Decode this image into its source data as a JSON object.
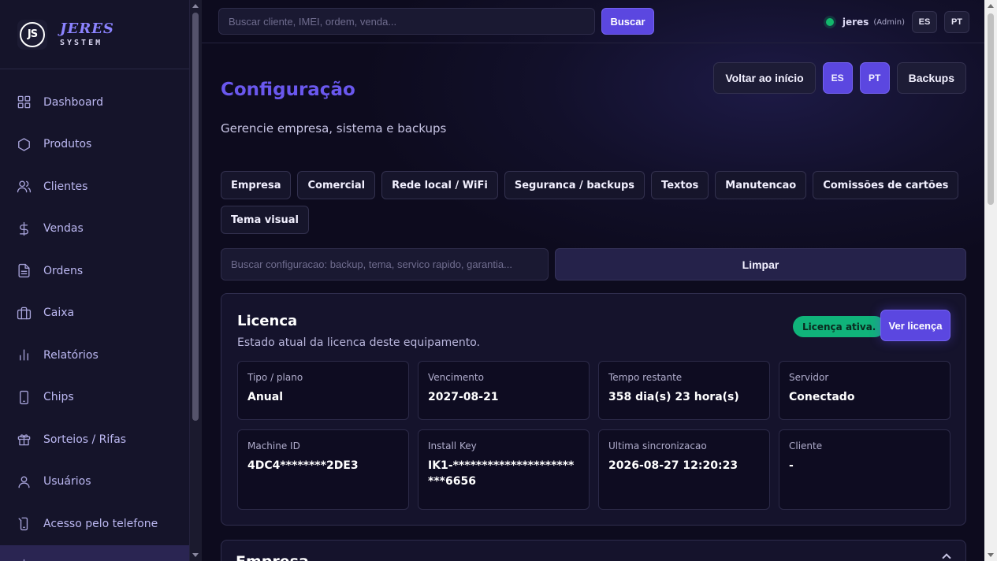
{
  "brand": {
    "logo_text": "JS",
    "name": "JERES",
    "sub": "SYSTEM"
  },
  "sidebar": {
    "items": [
      {
        "label": "Dashboard",
        "icon": "grid-icon"
      },
      {
        "label": "Produtos",
        "icon": "hexagon-icon"
      },
      {
        "label": "Clientes",
        "icon": "users-icon"
      },
      {
        "label": "Vendas",
        "icon": "dollar-icon"
      },
      {
        "label": "Ordens",
        "icon": "document-icon"
      },
      {
        "label": "Caixa",
        "icon": "briefcase-icon"
      },
      {
        "label": "Relatórios",
        "icon": "bar-chart-icon"
      },
      {
        "label": "Chips",
        "icon": "phone-icon"
      },
      {
        "label": "Sorteios / Rifas",
        "icon": "gift-icon"
      },
      {
        "label": "Usuários",
        "icon": "user-icon"
      },
      {
        "label": "Acesso pelo telefone",
        "icon": "phone-access-icon"
      },
      {
        "label": "",
        "icon": "gear-icon"
      }
    ]
  },
  "topbar": {
    "search_placeholder": "Buscar cliente, IMEI, ordem, venda...",
    "search_button": "Buscar",
    "user_name": "jeres",
    "user_role": "(Admin)",
    "lang_es": "ES",
    "lang_pt": "PT",
    "status_color": "#13b86c"
  },
  "page": {
    "title": "Configuração",
    "subtitle": "Gerencie empresa, sistema e backups",
    "actions": {
      "home": "Voltar ao início",
      "es": "ES",
      "pt": "PT",
      "backups": "Backups"
    }
  },
  "tabs": [
    "Empresa",
    "Comercial",
    "Rede local / WiFi",
    "Seguranca / backups",
    "Textos",
    "Manutencao",
    "Comissões de cartões",
    "Tema visual"
  ],
  "config_search": {
    "placeholder": "Buscar configuracao: backup, tema, servico rapido, garantia...",
    "clear_button": "Limpar"
  },
  "license": {
    "title": "Licenca",
    "subtitle": "Estado atual da licenca deste equipamento.",
    "badge": "Licença ativa.",
    "button": "Ver licença",
    "fields": [
      {
        "label": "Tipo / plano",
        "value": "Anual"
      },
      {
        "label": "Vencimento",
        "value": "2027-08-21"
      },
      {
        "label": "Tempo restante",
        "value": "358 dia(s) 23 hora(s)"
      },
      {
        "label": "Servidor",
        "value": "Conectado"
      },
      {
        "label": "Machine ID",
        "value": "4DC4********2DE3"
      },
      {
        "label": "Install Key",
        "value": "IK1-************************6656"
      },
      {
        "label": "Ultima sincronizacao",
        "value": "2026-08-27 12:20:23"
      },
      {
        "label": "Cliente",
        "value": "-"
      }
    ]
  },
  "next_section": {
    "title": "Empresa"
  },
  "colors": {
    "accent": "#5b47e0",
    "title": "#6a58ee",
    "badge": "#10b37a"
  }
}
